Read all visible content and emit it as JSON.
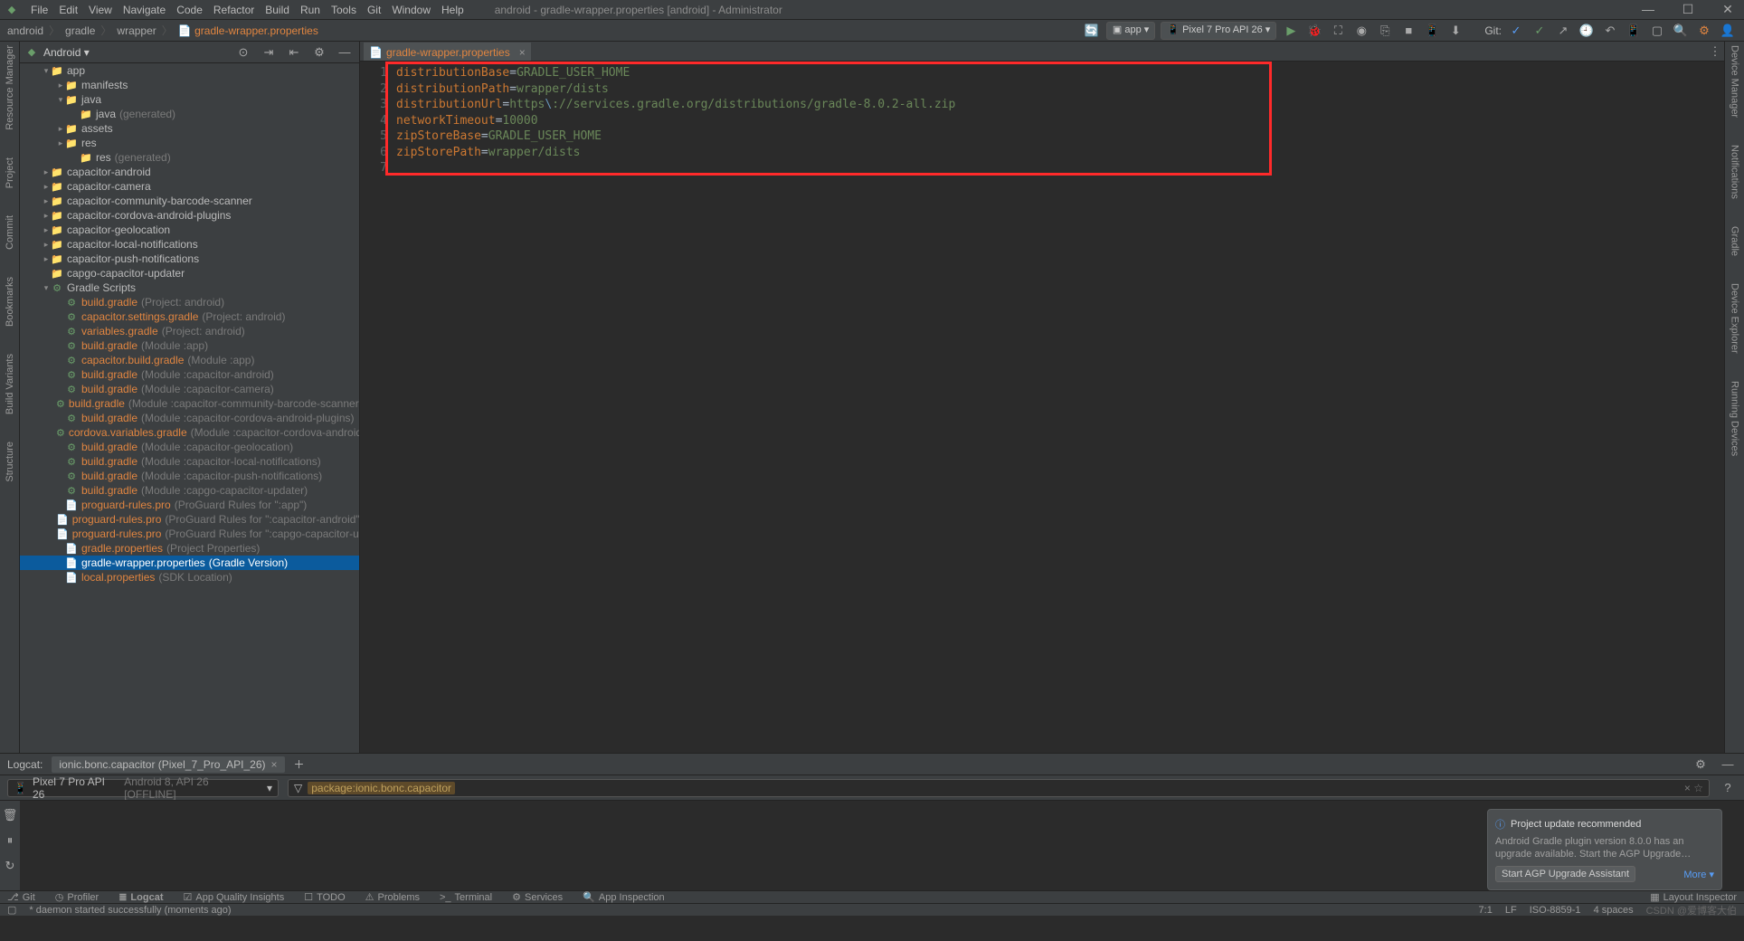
{
  "title": "android - gradle-wrapper.properties [android] - Administrator",
  "menu": [
    "File",
    "Edit",
    "View",
    "Navigate",
    "Code",
    "Refactor",
    "Build",
    "Run",
    "Tools",
    "Git",
    "Window",
    "Help"
  ],
  "breadcrumbs": {
    "parts": [
      "android",
      "gradle",
      "wrapper"
    ],
    "file": "gradle-wrapper.properties"
  },
  "toolbar": {
    "run_config": "app",
    "device": "Pixel 7 Pro API 26",
    "git_label": "Git:"
  },
  "project_dropdown": "Android",
  "left_gutter": [
    {
      "label": "Resource Manager"
    },
    {
      "label": "Project"
    },
    {
      "label": "Commit"
    },
    {
      "label": "Bookmarks"
    },
    {
      "label": "Build Variants"
    },
    {
      "label": "Structure"
    }
  ],
  "right_gutter": [
    {
      "label": "Device Manager"
    },
    {
      "label": "Notifications"
    },
    {
      "label": "Gradle"
    },
    {
      "label": "Device Explorer"
    },
    {
      "label": "Running Devices"
    }
  ],
  "tree": [
    {
      "d": 0,
      "c": "v",
      "icon": "📁",
      "label": "app",
      "orange": false
    },
    {
      "d": 1,
      "c": ">",
      "icon": "📁",
      "label": "manifests",
      "orange": false
    },
    {
      "d": 1,
      "c": "v",
      "icon": "📁",
      "label": "java",
      "orange": false,
      "folder_blue": true
    },
    {
      "d": 2,
      "c": "",
      "icon": "📁",
      "label": "java",
      "orange": false,
      "dim": "(generated)",
      "folder_blue": true
    },
    {
      "d": 1,
      "c": ">",
      "icon": "📁",
      "label": "assets",
      "orange": false
    },
    {
      "d": 1,
      "c": ">",
      "icon": "📁",
      "label": "res",
      "orange": false
    },
    {
      "d": 2,
      "c": "",
      "icon": "📁",
      "label": "res",
      "orange": false,
      "dim": "(generated)"
    },
    {
      "d": 0,
      "c": ">",
      "icon": "📁",
      "label": "capacitor-android",
      "orange": false
    },
    {
      "d": 0,
      "c": ">",
      "icon": "📁",
      "label": "capacitor-camera",
      "orange": false
    },
    {
      "d": 0,
      "c": ">",
      "icon": "📁",
      "label": "capacitor-community-barcode-scanner",
      "orange": false
    },
    {
      "d": 0,
      "c": ">",
      "icon": "📁",
      "label": "capacitor-cordova-android-plugins",
      "orange": false
    },
    {
      "d": 0,
      "c": ">",
      "icon": "📁",
      "label": "capacitor-geolocation",
      "orange": false
    },
    {
      "d": 0,
      "c": ">",
      "icon": "📁",
      "label": "capacitor-local-notifications",
      "orange": false
    },
    {
      "d": 0,
      "c": ">",
      "icon": "📁",
      "label": "capacitor-push-notifications",
      "orange": false
    },
    {
      "d": 0,
      "c": "",
      "icon": "📁",
      "label": "capgo-capacitor-updater",
      "orange": false
    },
    {
      "d": 0,
      "c": "v",
      "icon": "⚙",
      "label": "Gradle Scripts",
      "orange": false,
      "gradle": true
    },
    {
      "d": 1,
      "c": "",
      "icon": "⚙",
      "label": "build.gradle",
      "orange": true,
      "dim": "(Project: android)",
      "gradle": true
    },
    {
      "d": 1,
      "c": "",
      "icon": "⚙",
      "label": "capacitor.settings.gradle",
      "orange": true,
      "dim": "(Project: android)",
      "gradle": true
    },
    {
      "d": 1,
      "c": "",
      "icon": "⚙",
      "label": "variables.gradle",
      "orange": true,
      "dim": "(Project: android)",
      "gradle": true
    },
    {
      "d": 1,
      "c": "",
      "icon": "⚙",
      "label": "build.gradle",
      "orange": true,
      "dim": "(Module :app)",
      "gradle": true
    },
    {
      "d": 1,
      "c": "",
      "icon": "⚙",
      "label": "capacitor.build.gradle",
      "orange": true,
      "dim": "(Module :app)",
      "gradle": true
    },
    {
      "d": 1,
      "c": "",
      "icon": "⚙",
      "label": "build.gradle",
      "orange": true,
      "dim": "(Module :capacitor-android)",
      "gradle": true
    },
    {
      "d": 1,
      "c": "",
      "icon": "⚙",
      "label": "build.gradle",
      "orange": true,
      "dim": "(Module :capacitor-camera)",
      "gradle": true
    },
    {
      "d": 1,
      "c": "",
      "icon": "⚙",
      "label": "build.gradle",
      "orange": true,
      "dim": "(Module :capacitor-community-barcode-scanner)",
      "gradle": true
    },
    {
      "d": 1,
      "c": "",
      "icon": "⚙",
      "label": "build.gradle",
      "orange": true,
      "dim": "(Module :capacitor-cordova-android-plugins)",
      "gradle": true
    },
    {
      "d": 1,
      "c": "",
      "icon": "⚙",
      "label": "cordova.variables.gradle",
      "orange": true,
      "dim": "(Module :capacitor-cordova-android-plugin",
      "gradle": true
    },
    {
      "d": 1,
      "c": "",
      "icon": "⚙",
      "label": "build.gradle",
      "orange": true,
      "dim": "(Module :capacitor-geolocation)",
      "gradle": true
    },
    {
      "d": 1,
      "c": "",
      "icon": "⚙",
      "label": "build.gradle",
      "orange": true,
      "dim": "(Module :capacitor-local-notifications)",
      "gradle": true
    },
    {
      "d": 1,
      "c": "",
      "icon": "⚙",
      "label": "build.gradle",
      "orange": true,
      "dim": "(Module :capacitor-push-notifications)",
      "gradle": true
    },
    {
      "d": 1,
      "c": "",
      "icon": "⚙",
      "label": "build.gradle",
      "orange": true,
      "dim": "(Module :capgo-capacitor-updater)",
      "gradle": true
    },
    {
      "d": 1,
      "c": "",
      "icon": "📄",
      "label": "proguard-rules.pro",
      "orange": true,
      "dim": "(ProGuard Rules for \":app\")"
    },
    {
      "d": 1,
      "c": "",
      "icon": "📄",
      "label": "proguard-rules.pro",
      "orange": true,
      "dim": "(ProGuard Rules for \":capacitor-android\")"
    },
    {
      "d": 1,
      "c": "",
      "icon": "📄",
      "label": "proguard-rules.pro",
      "orange": true,
      "dim": "(ProGuard Rules for \":capgo-capacitor-updater\")"
    },
    {
      "d": 1,
      "c": "",
      "icon": "📄",
      "label": "gradle.properties",
      "orange": true,
      "dim": "(Project Properties)"
    },
    {
      "d": 1,
      "c": "",
      "icon": "📄",
      "label": "gradle-wrapper.properties",
      "orange": true,
      "dim": "(Gradle Version)",
      "selected": true
    },
    {
      "d": 1,
      "c": "",
      "icon": "📄",
      "label": "local.properties",
      "orange": true,
      "dim": "(SDK Location)"
    }
  ],
  "editor": {
    "tab": "gradle-wrapper.properties",
    "lines": [
      {
        "n": 1,
        "key": "distributionBase",
        "val": "GRADLE_USER_HOME"
      },
      {
        "n": 2,
        "key": "distributionPath",
        "val": "wrapper/dists"
      },
      {
        "n": 3,
        "key": "distributionUrl",
        "val": "https\\://services.gradle.org/distributions/gradle-8.0.2-all.zip",
        "esc": true
      },
      {
        "n": 4,
        "key": "networkTimeout",
        "val": "10000"
      },
      {
        "n": 5,
        "key": "zipStoreBase",
        "val": "GRADLE_USER_HOME"
      },
      {
        "n": 6,
        "key": "zipStorePath",
        "val": "wrapper/dists"
      },
      {
        "n": 7,
        "key": "",
        "val": ""
      }
    ]
  },
  "logcat": {
    "title": "Logcat:",
    "tab": "ionic.bonc.capacitor (Pixel_7_Pro_API_26)",
    "device": "Pixel 7 Pro API 26",
    "device_detail": "Android 8, API 26 [OFFLINE]",
    "filter_prefix": "package:",
    "filter_value": "ionic.bonc.capacitor"
  },
  "notification": {
    "title": "Project update recommended",
    "body": "Android Gradle plugin version 8.0.0 has an upgrade available. Start the AGP Upgrade…",
    "action": "Start AGP Upgrade Assistant",
    "more": "More ▾"
  },
  "toolwindows": [
    "Git",
    "Profiler",
    "Logcat",
    "App Quality Insights",
    "TODO",
    "Problems",
    "Terminal",
    "Services",
    "App Inspection"
  ],
  "toolwindows_right": "Layout Inspector",
  "status": {
    "msg": "* daemon started successfully (moments ago)",
    "cursor": "7:1",
    "lf": "LF",
    "encoding": "ISO-8859-1",
    "indent": "4 spaces",
    "watermark": "CSDN @爱博客大伯"
  }
}
